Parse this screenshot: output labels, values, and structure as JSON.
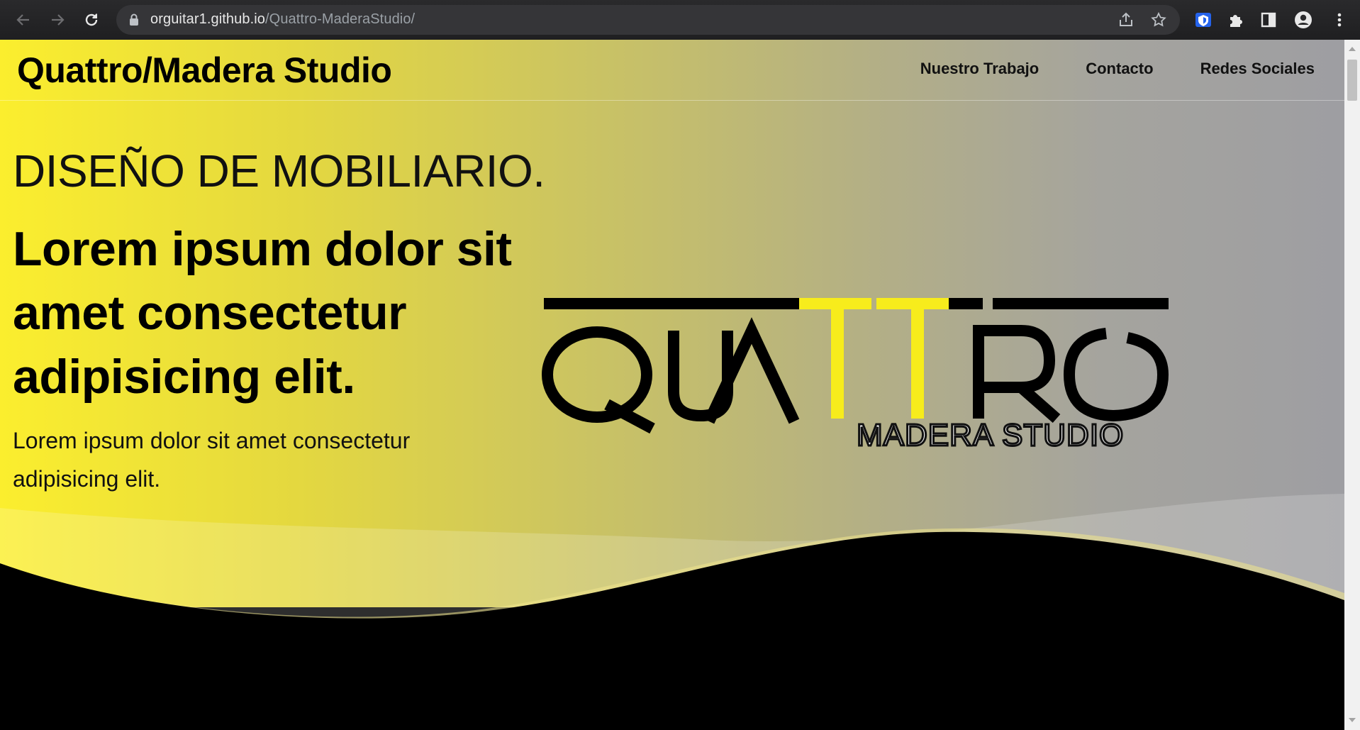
{
  "browser": {
    "url_host": "orguitar1.github.io",
    "url_path": "/Quattro-MaderaStudio/"
  },
  "site": {
    "brand": "Quattro/Madera Studio",
    "nav": [
      "Nuestro Trabajo",
      "Contacto",
      "Redes Sociales"
    ]
  },
  "hero": {
    "subtitle": "DISEÑO DE MOBILIARIO.",
    "heading": "Lorem ipsum dolor sit amet consectetur adipisicing elit.",
    "text": "Lorem ipsum dolor sit amet consectetur adipisicing elit."
  },
  "logo": {
    "word": "QUATTRO",
    "tagline": "MADERA STUDIO"
  },
  "colors": {
    "accent_yellow": "#fbee2e",
    "gray": "#9e9ea2",
    "black": "#000000"
  }
}
